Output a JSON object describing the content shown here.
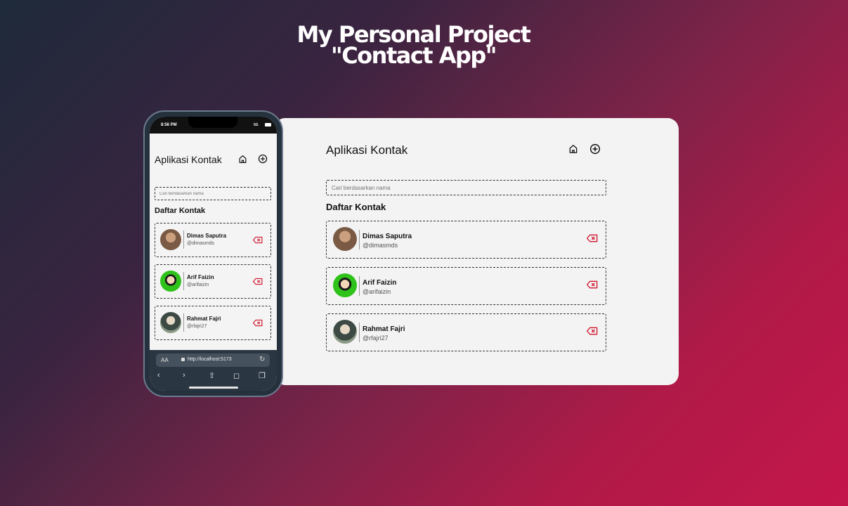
{
  "headline": {
    "line1": "My Personal Project",
    "line2": "\"Contact App\""
  },
  "app": {
    "title": "Aplikasi Kontak",
    "search_placeholder": "Cari berdasarkan nama",
    "list_title": "Daftar Kontak",
    "home_icon": "home-icon",
    "add_icon": "plus-circle-icon",
    "delete_icon": "backspace-x-icon",
    "delete_color": "#d0162e"
  },
  "contacts": [
    {
      "name": "Dimas Saputra",
      "username": "@dimasmds",
      "avatar_color": "#7a5a44"
    },
    {
      "name": "Arif Faizin",
      "username": "@arifaizin",
      "avatar_color": "#2fc21a"
    },
    {
      "name": "Rahmat Fajri",
      "username": "@rfajri27",
      "avatar_color": "#5f6d5a"
    }
  ],
  "phone": {
    "time": "8:56 PM",
    "signal": "5G",
    "browser": {
      "aa_label": "AA",
      "url": "http://localhost:5173"
    }
  }
}
